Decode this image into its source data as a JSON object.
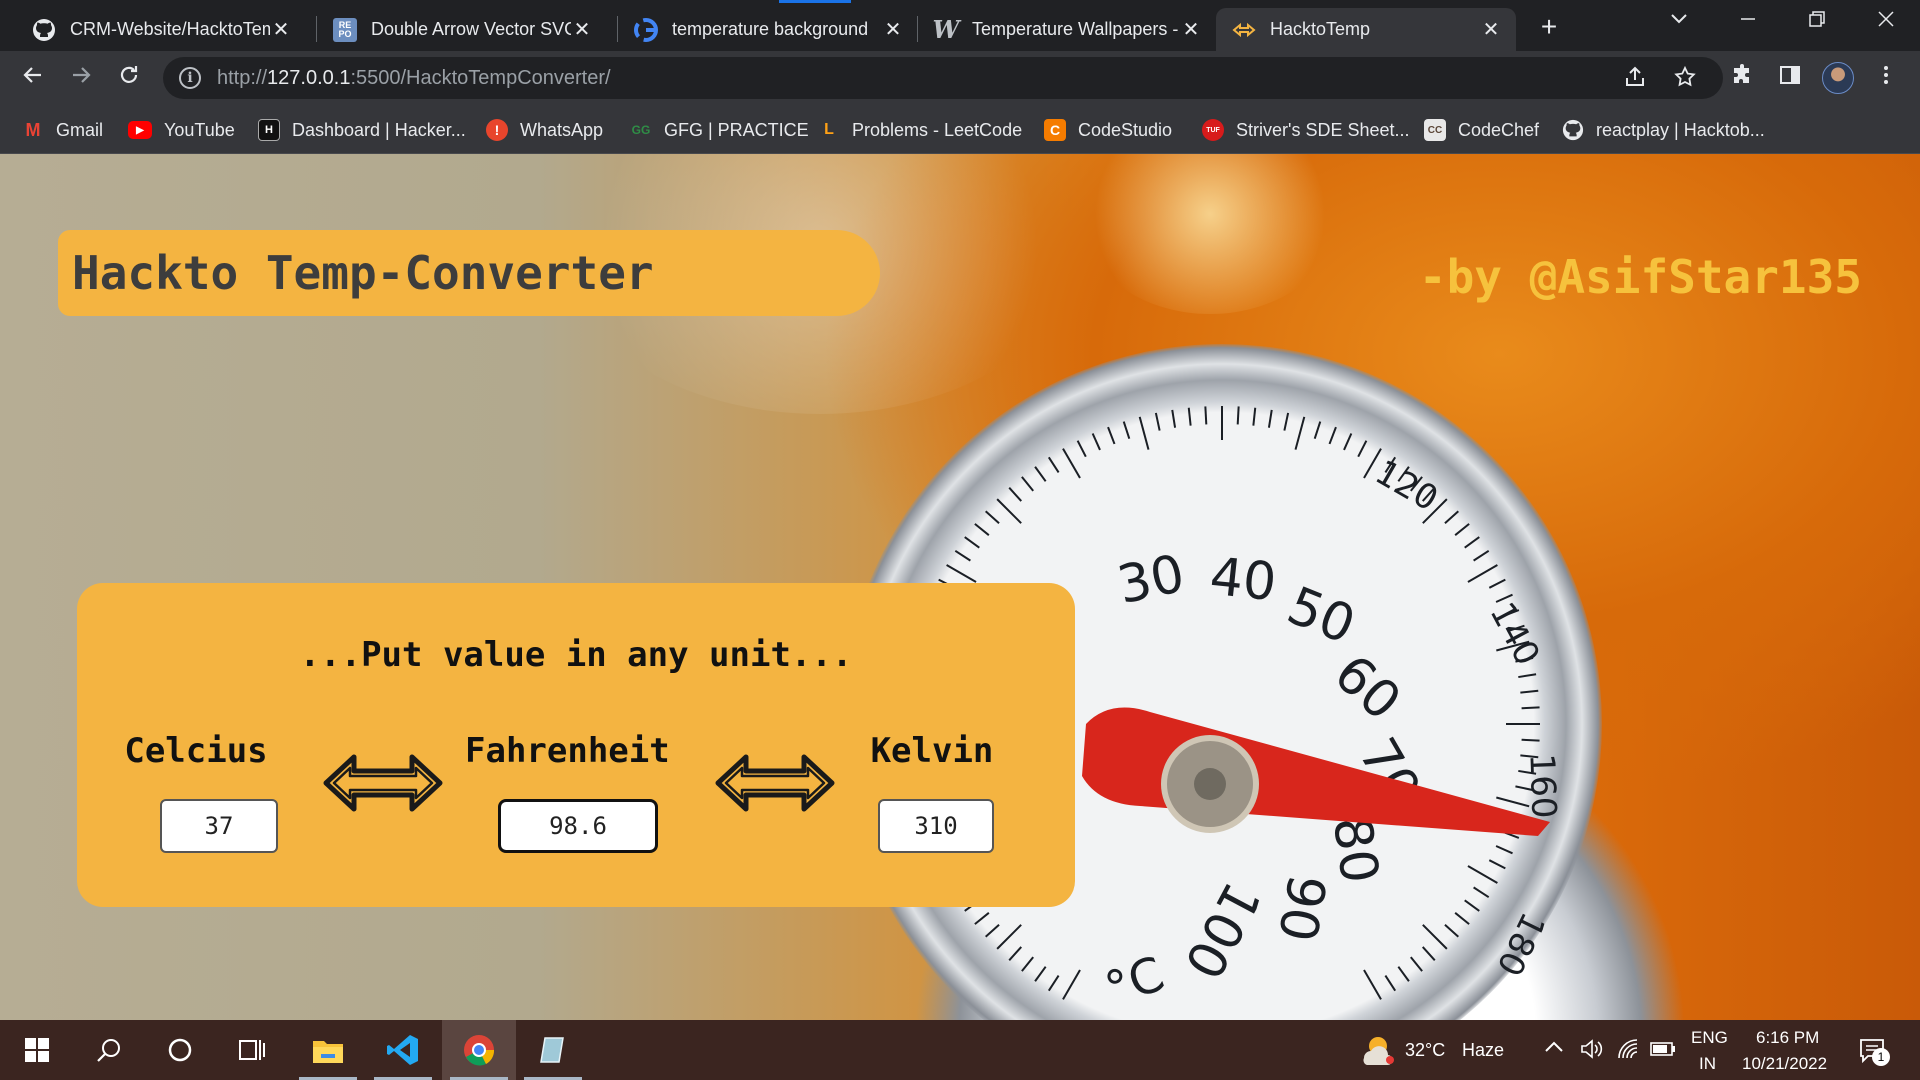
{
  "browser": {
    "tabs": [
      {
        "title": "CRM-Website/HacktoTem",
        "icon": "github-icon"
      },
      {
        "title": "Double Arrow Vector SVG",
        "icon": "svgrepo-icon",
        "icon_text": "RE PO"
      },
      {
        "title": "temperature background",
        "icon": "google-icon"
      },
      {
        "title": "Temperature Wallpapers -",
        "icon": "wallpaper-site-icon",
        "icon_text": "W"
      },
      {
        "title": "HacktoTemp",
        "icon": "double-arrow-icon",
        "active": true
      }
    ],
    "close_glyph": "✕",
    "new_tab_glyph": "+",
    "url": {
      "scheme": "http://",
      "host": "127.0.0.1",
      "path": ":5500/HacktoTempConverter/"
    },
    "bookmarks": [
      {
        "label": "Gmail",
        "icon": "gmail-icon",
        "icon_text": "M",
        "color": "#ea4335"
      },
      {
        "label": "YouTube",
        "icon": "youtube-icon",
        "icon_text": "▶",
        "color": "#ff0000"
      },
      {
        "label": "Dashboard | Hacker...",
        "icon": "hackerrank-icon",
        "icon_text": "H",
        "color": "#111111"
      },
      {
        "label": "WhatsApp",
        "icon": "whatsapp-icon",
        "icon_text": "!",
        "color": "#e8452c"
      },
      {
        "label": "GFG | PRACTICE",
        "icon": "gfg-icon",
        "icon_text": "GG",
        "color": "#2f8d46"
      },
      {
        "label": "Problems - LeetCode",
        "icon": "leetcode-icon",
        "icon_text": "L",
        "color": "#ffa116"
      },
      {
        "label": "CodeStudio",
        "icon": "codestudio-icon",
        "icon_text": "C",
        "color": "#f57c00"
      },
      {
        "label": "Striver's SDE Sheet...",
        "icon": "tuf-icon",
        "icon_text": "TUF",
        "color": "#d81b1b"
      },
      {
        "label": "CodeChef",
        "icon": "codechef-icon",
        "icon_text": "CC",
        "color": "#5b4638"
      },
      {
        "label": "reactplay | Hacktob...",
        "icon": "github-icon",
        "icon_text": "",
        "color": "#ffffff"
      }
    ]
  },
  "app": {
    "title": "Hackto Temp-Converter",
    "author": "-by @AsifStar135",
    "heading": "...Put value in any unit...",
    "units": [
      {
        "label": "Celcius",
        "value": "37"
      },
      {
        "label": "Fahrenheit",
        "value": "98.6"
      },
      {
        "label": "Kelvin",
        "value": "310"
      }
    ],
    "accent_color": "#f4b441",
    "author_color": "#f6c23d"
  },
  "background_dial": {
    "labels": [
      "30",
      "40",
      "50",
      "60",
      "70",
      "80",
      "90",
      "100",
      "120",
      "140",
      "160",
      "180",
      "°C"
    ]
  },
  "taskbar": {
    "weather": {
      "temp": "32°C",
      "condition": "Haze"
    },
    "language": {
      "line1": "ENG",
      "line2": "IN"
    },
    "time": "6:16 PM",
    "date": "10/21/2022",
    "notifications": "1"
  }
}
